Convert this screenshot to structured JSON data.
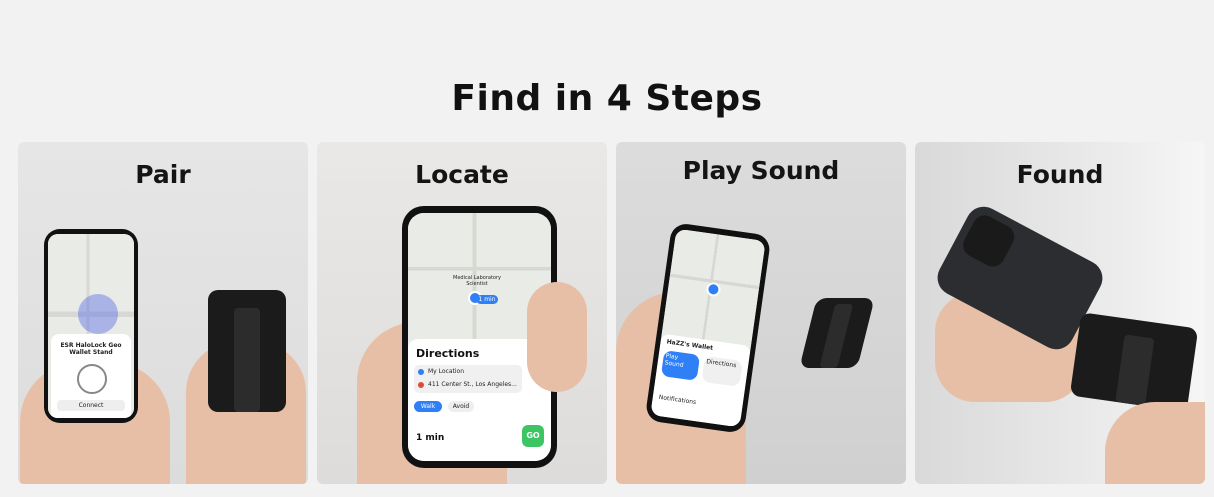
{
  "title": "Find in 4 Steps",
  "steps": [
    {
      "label": "Pair"
    },
    {
      "label": "Locate"
    },
    {
      "label": "Play Sound"
    },
    {
      "label": "Found"
    }
  ],
  "pair_screen": {
    "device_name": "ESR HaloLock Geo Wallet Stand",
    "button": "Connect"
  },
  "locate_screen": {
    "map_place": "Medical Laboratory Scientist",
    "eta_badge": "1 min",
    "sheet_title": "Directions",
    "from": "My Location",
    "to": "411 Center St., Los Angeles...",
    "mode": "Walk",
    "avoid": "Avoid",
    "duration": "1 min",
    "go": "GO"
  },
  "sound_screen": {
    "item_title": "HaZZ's Wallet",
    "action_play": "Play Sound",
    "action_directions": "Directions",
    "notifications": "Notifications"
  },
  "colors": {
    "background": "#f2f2f2",
    "title": "#111111",
    "accent_green": "#3dc463",
    "accent_blue": "#2f7ff6"
  }
}
